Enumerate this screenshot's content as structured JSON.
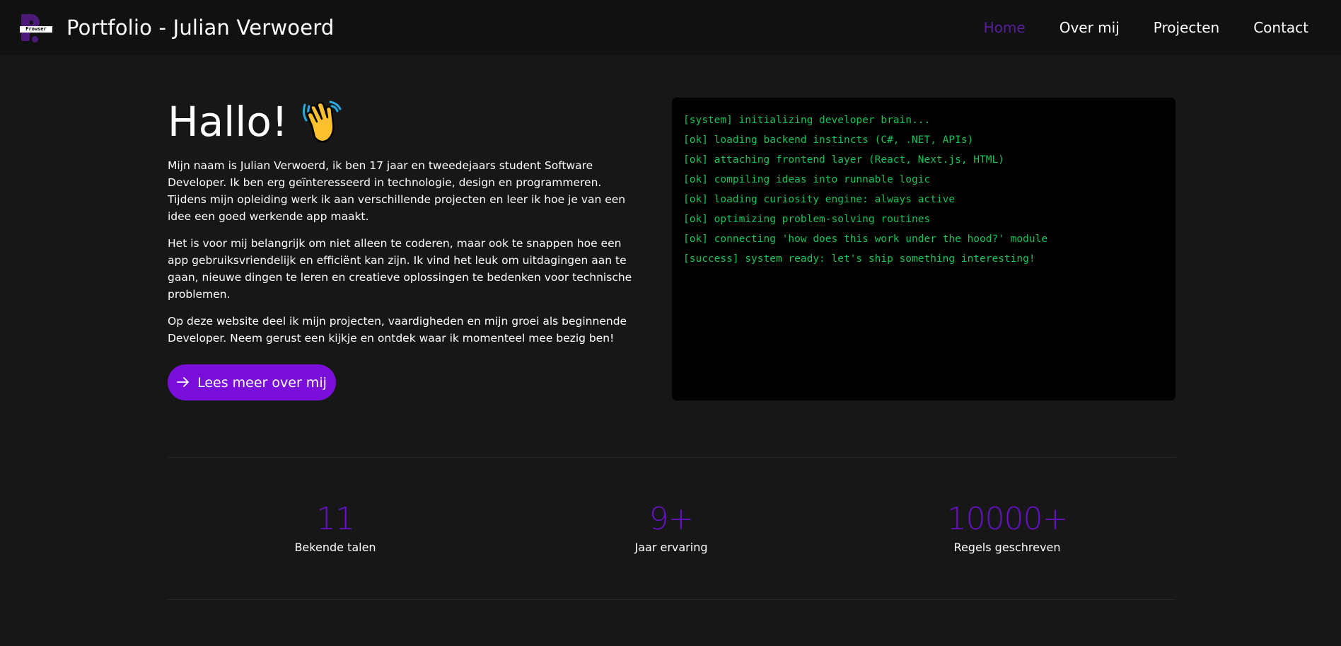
{
  "header": {
    "logo_text": "Prowser",
    "title": "Portfolio - Julian Verwoerd",
    "nav": [
      {
        "label": "Home",
        "active": true
      },
      {
        "label": "Over mij",
        "active": false
      },
      {
        "label": "Projecten",
        "active": false
      },
      {
        "label": "Contact",
        "active": false
      }
    ]
  },
  "intro": {
    "title": "Hallo!",
    "title_icon": "waving-hand-icon",
    "paragraphs": [
      "Mijn naam is Julian Verwoerd, ik ben 17 jaar en tweedejaars student Software Developer. Ik ben erg geïnteresseerd in technologie, design en programmeren. Tijdens mijn opleiding werk ik aan verschillende projecten en leer ik hoe je van een idee een goed werkende app maakt.",
      "Het is voor mij belangrijk om niet alleen te coderen, maar ook te snappen hoe een app gebruiksvriendelijk en efficiënt kan zijn. Ik vind het leuk om uitdagingen aan te gaan, nieuwe dingen te leren en creatieve oplossingen te bedenken voor technische problemen.",
      "Op deze website deel ik mijn projecten, vaardigheden en mijn groei als beginnende Developer. Neem gerust een kijkje en ontdek waar ik momenteel mee bezig ben!"
    ],
    "cta_label": "Lees meer over mij",
    "cta_icon": "arrow-right-icon"
  },
  "terminal": {
    "lines": [
      "[system] initializing developer brain...",
      "[ok] loading backend instincts (C#, .NET, APIs)",
      "[ok] attaching frontend layer (React, Next.js, HTML)",
      "[ok] compiling ideas into runnable logic",
      "[ok] loading curiosity engine: always active",
      "[ok] optimizing problem-solving routines",
      "[ok] connecting 'how does this work under the hood?' module",
      "[success] system ready: let's ship something interesting!"
    ]
  },
  "stats": [
    {
      "value": "11",
      "label": "Bekende talen"
    },
    {
      "value": "9+",
      "label": "Jaar ervaring"
    },
    {
      "value": "10000+",
      "label": "Regels geschreven"
    }
  ],
  "colors": {
    "background": "#171717",
    "navbar": "#111111",
    "accent": "#7a0fdb",
    "stat_accent": "#6612c4",
    "terminal_text": "#16c25a"
  }
}
